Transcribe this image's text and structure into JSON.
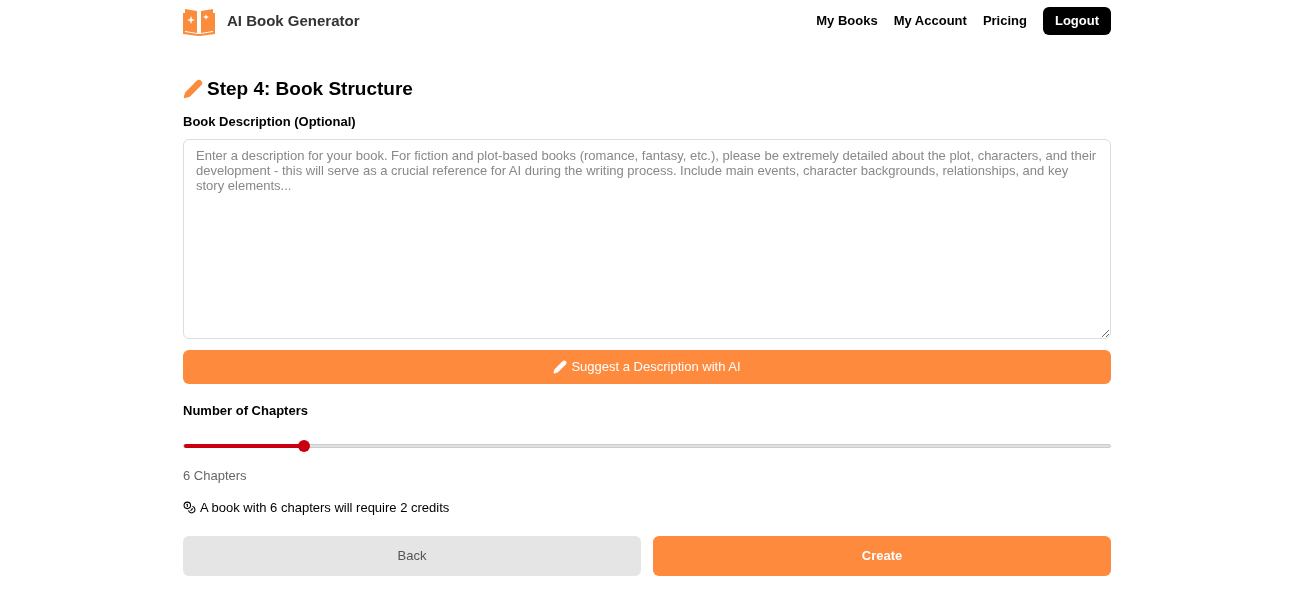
{
  "header": {
    "brand": "AI Book Generator",
    "nav": [
      {
        "label": "My Books",
        "kind": "link"
      },
      {
        "label": "My Account",
        "kind": "link"
      },
      {
        "label": "Pricing",
        "kind": "link"
      },
      {
        "label": "Logout",
        "kind": "button"
      }
    ]
  },
  "title": "Step 4: Book Structure",
  "description": {
    "label": "Book Description (Optional)",
    "placeholder": "Enter a description for your book. For fiction and plot-based books (romance, fantasy, etc.), please be extremely detailed about the plot, characters, and their development - this will serve as a crucial reference for AI during the writing process. Include main events, character backgrounds, relationships, and key story elements..."
  },
  "suggest_button": "Suggest a Description with AI",
  "chapters": {
    "label": "Number of Chapters",
    "level": 0.13,
    "reading": "6 Chapters",
    "credits_note": "A book with 6 chapters will require 2 credits"
  },
  "buttons": [
    {
      "label": "Back",
      "kind": "secondary"
    },
    {
      "label": "Create",
      "kind": "primary"
    }
  ]
}
